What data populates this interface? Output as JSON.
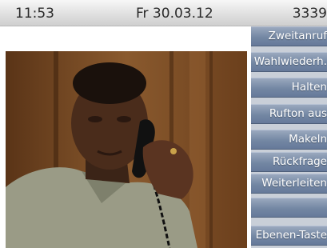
{
  "status_bar": {
    "time": "11:53",
    "date": "Fr 30.03.12",
    "extension": "3339"
  },
  "softkeys": [
    {
      "label": "Zweitanruf"
    },
    {
      "label": "Wahlwiederh."
    },
    {
      "label": "Halten"
    },
    {
      "label": "Rufton aus"
    },
    {
      "label": "Makeln"
    },
    {
      "label": "Rückfrage"
    },
    {
      "label": "Weiterleiten"
    },
    {
      "label": ""
    },
    {
      "label": "Ebenen-Taste"
    }
  ],
  "colors": {
    "softkey_blue": "#7387a3",
    "status_bar_gray": "#dedede"
  }
}
